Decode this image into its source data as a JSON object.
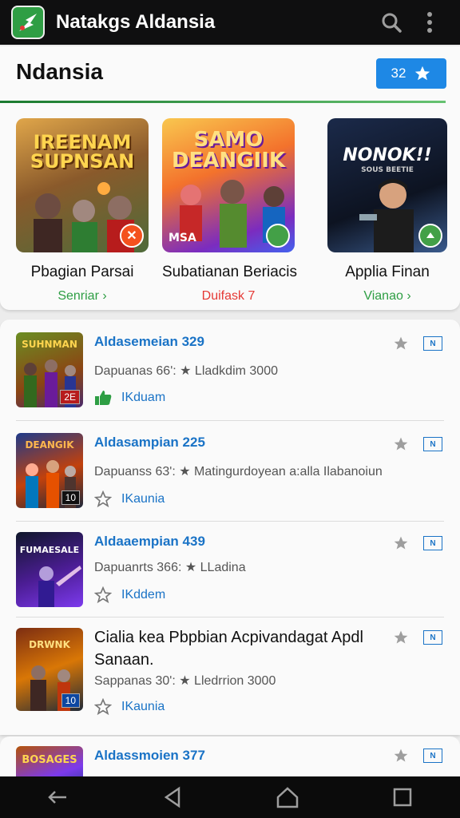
{
  "appbar": {
    "title": "Natakgs Aldansia",
    "icons": [
      "app-logo-icon",
      "search-icon",
      "more-vert-icon"
    ]
  },
  "section": {
    "title": "Ndansia",
    "button_count": "32"
  },
  "featured": [
    {
      "art_title": "IREENAM SUPNSAN",
      "title": "Pbagian Parsai",
      "link": "Senriar ›",
      "link_color": "#2e9e44",
      "badge": "✕",
      "badge_color": "#f4511e",
      "art_bg": "linear-gradient(160deg,#e0a64a,#8a5a2b 45%,#4f6b3a)"
    },
    {
      "art_title": "SAMO DEANGIIK",
      "art_tag": "MSA",
      "title": "Subatianan Beriacis",
      "link": "Duifask 7",
      "link_color": "#e53935",
      "badge": "",
      "badge_color": "#43a047",
      "art_bg": "linear-gradient(160deg,#f9c74f,#f3722c 40%,#7b2cbf 80%,#4361ee)"
    },
    {
      "art_title": "NONOK!!",
      "art_tag": "SOUS BEETIE",
      "title": "Applia Finan",
      "link": "Vianao ›",
      "link_color": "#2e9e44",
      "badge": "",
      "badge_color": "#43a047",
      "art_bg": "linear-gradient(160deg,#1b2a4a,#0d1321 60%,#3a5a8c)"
    }
  ],
  "list": [
    {
      "title": "Aldasemeian 329",
      "meta": "Dapuanas 66ʹ: ★ Lladkdim 3000",
      "action": "IKduam",
      "action_icon": "thumb-up-icon",
      "thumb_tag": "2E",
      "thumb_text": "SUHNMAN",
      "thumb_bg": "linear-gradient(160deg,#6b8e23,#8b4513 60%,#4a2a6a)"
    },
    {
      "title": "Aldasampian 225",
      "meta": "Dapuanss 63ʹ: ★ Matingurdoyean a:alla Ilabanoiun",
      "action": "IKaunia",
      "action_icon": "star-outline-icon",
      "thumb_tag": "10",
      "thumb_text": "DEANGIK",
      "thumb_bg": "linear-gradient(160deg,#1e3a8a,#c2410c 55%,#1e293b)"
    },
    {
      "title": "Aldaaempian 439",
      "meta": "Dapuanrts 366: ★ LLadina",
      "action": "IKddem",
      "action_icon": "star-outline-icon",
      "thumb_tag": "",
      "thumb_text": "FUMAESALE",
      "thumb_bg": "linear-gradient(160deg,#0f172a,#4c1d95 55%,#7c3aed)"
    },
    {
      "title": "Cialia kea Pbpbian Acpivandagat Apdl Sanaan.",
      "meta": "Sappanas 30ʹ: ★ Lledrrion 3000",
      "action": "IKaunia",
      "action_icon": "star-outline-icon",
      "thumb_tag": "10",
      "thumb_text": "DRWNK",
      "thumb_bg": "linear-gradient(160deg,#7c2d12,#d97706 50%,#1f2937)"
    },
    {
      "title": "Aldassmoien 377",
      "meta": "",
      "action": "",
      "action_icon": "",
      "thumb_tag": "",
      "thumb_text": "BOSAGES",
      "thumb_bg": "linear-gradient(160deg,#b45309,#7c3aed 60%,#1e3a8a)"
    }
  ],
  "tv_label": "N",
  "colors": {
    "accent": "#1e88e5",
    "green": "#2e9e44",
    "link_blue": "#1a73c6"
  },
  "navbar": {
    "icons": [
      "back-arrow-icon",
      "back-triangle-icon",
      "home-icon",
      "recents-icon"
    ]
  }
}
